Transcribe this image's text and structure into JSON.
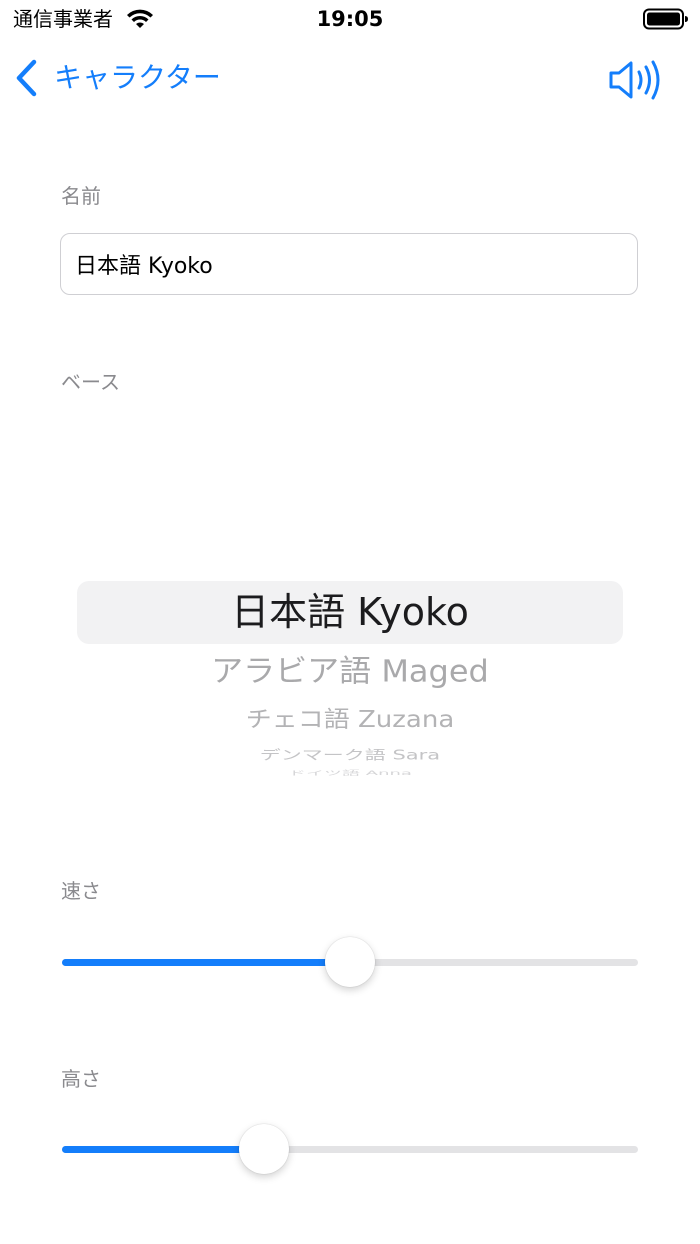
{
  "status_bar": {
    "carrier": "通信事業者",
    "time": "19:05"
  },
  "nav": {
    "back_label": "キャラクター",
    "back_icon": "chevron-left-icon",
    "speaker_icon": "speaker-wave-icon",
    "accent_color": "#147EFB"
  },
  "form": {
    "name_label": "名前",
    "name_value": "日本語 Kyoko",
    "base_label": "ベース",
    "speed_label": "速さ",
    "pitch_label": "高さ"
  },
  "picker": {
    "selected_index": 0,
    "items": [
      "日本語 Kyoko",
      "アラビア語 Maged",
      "チェコ語 Zuzana",
      "デンマーク語 Sara",
      "ドイツ語 Anna"
    ]
  },
  "sliders": {
    "speed": {
      "value": 0.5
    },
    "pitch": {
      "value": 0.35
    }
  }
}
